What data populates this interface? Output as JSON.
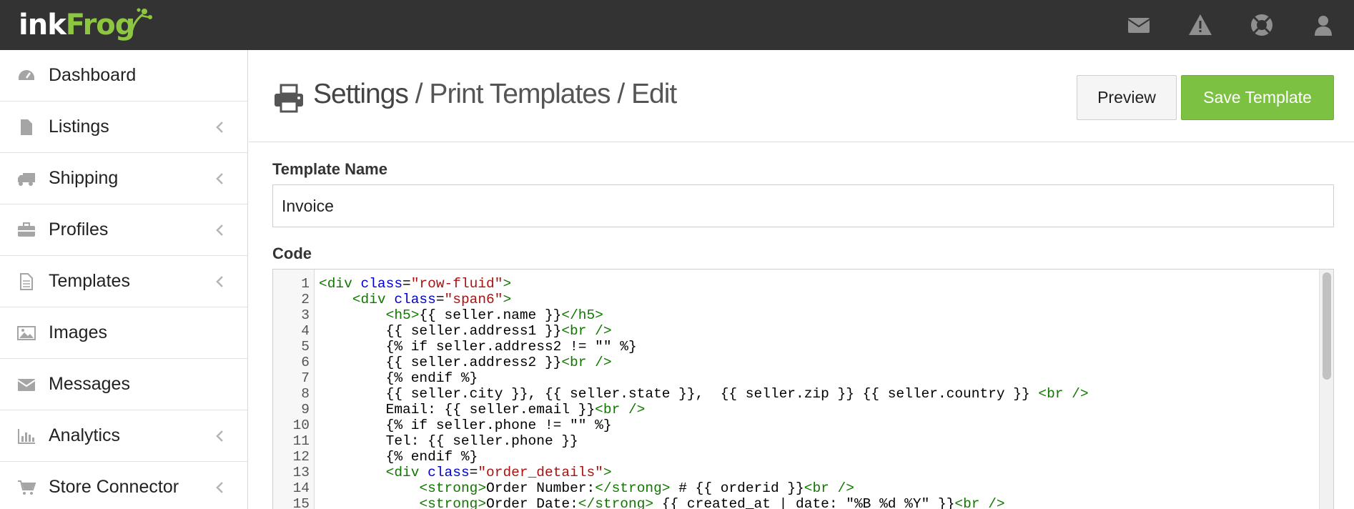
{
  "brand": {
    "ink": "ink",
    "frog": "Frog",
    "accent": "#8dc63f"
  },
  "topbar": {
    "icons": [
      "envelope-icon",
      "warning-icon",
      "lifebuoy-icon",
      "user-icon"
    ]
  },
  "sidebar": {
    "items": [
      {
        "label": "Dashboard",
        "icon": "dashboard-icon",
        "expandable": false
      },
      {
        "label": "Listings",
        "icon": "file-icon",
        "expandable": true
      },
      {
        "label": "Shipping",
        "icon": "truck-icon",
        "expandable": true
      },
      {
        "label": "Profiles",
        "icon": "briefcase-icon",
        "expandable": true
      },
      {
        "label": "Templates",
        "icon": "document-icon",
        "expandable": true
      },
      {
        "label": "Images",
        "icon": "image-icon",
        "expandable": false
      },
      {
        "label": "Messages",
        "icon": "envelope-icon",
        "expandable": false
      },
      {
        "label": "Analytics",
        "icon": "bar-chart-icon",
        "expandable": true
      },
      {
        "label": "Store Connector",
        "icon": "cart-icon",
        "expandable": true
      }
    ]
  },
  "header": {
    "title": "Settings",
    "breadcrumb": " / Print Templates / Edit",
    "preview_label": "Preview",
    "save_label": "Save Template",
    "save_color": "#7cc142"
  },
  "form": {
    "name_label": "Template Name",
    "name_value": "Invoice",
    "code_label": "Code"
  },
  "code": {
    "lines": [
      {
        "n": "1",
        "tokens": [
          [
            "tag",
            "<div "
          ],
          [
            "attr",
            "class"
          ],
          [
            "plain",
            "="
          ],
          [
            "str",
            "\"row-fluid\""
          ],
          [
            "tag",
            ">"
          ]
        ]
      },
      {
        "n": "2",
        "tokens": [
          [
            "plain",
            "    "
          ],
          [
            "tag",
            "<div "
          ],
          [
            "attr",
            "class"
          ],
          [
            "plain",
            "="
          ],
          [
            "str",
            "\"span6\""
          ],
          [
            "tag",
            ">"
          ]
        ]
      },
      {
        "n": "3",
        "tokens": [
          [
            "plain",
            "        "
          ],
          [
            "tag",
            "<h5>"
          ],
          [
            "plain",
            "{{ seller.name }}"
          ],
          [
            "tag",
            "</h5>"
          ]
        ]
      },
      {
        "n": "4",
        "tokens": [
          [
            "plain",
            "        {{ seller.address1 }}"
          ],
          [
            "tag",
            "<br />"
          ]
        ]
      },
      {
        "n": "5",
        "tokens": [
          [
            "plain",
            "        {% if seller.address2 != \"\" %}"
          ]
        ]
      },
      {
        "n": "6",
        "tokens": [
          [
            "plain",
            "        {{ seller.address2 }}"
          ],
          [
            "tag",
            "<br />"
          ]
        ]
      },
      {
        "n": "7",
        "tokens": [
          [
            "plain",
            "        {% endif %}"
          ]
        ]
      },
      {
        "n": "8",
        "tokens": [
          [
            "plain",
            "        {{ seller.city }}, {{ seller.state }},  {{ seller.zip }} {{ seller.country }} "
          ],
          [
            "tag",
            "<br />"
          ]
        ]
      },
      {
        "n": "9",
        "tokens": [
          [
            "plain",
            "        Email: {{ seller.email }}"
          ],
          [
            "tag",
            "<br />"
          ]
        ]
      },
      {
        "n": "10",
        "tokens": [
          [
            "plain",
            "        {% if seller.phone != \"\" %}"
          ]
        ]
      },
      {
        "n": "11",
        "tokens": [
          [
            "plain",
            "        Tel: {{ seller.phone }}"
          ]
        ]
      },
      {
        "n": "12",
        "tokens": [
          [
            "plain",
            "        {% endif %}"
          ]
        ]
      },
      {
        "n": "13",
        "tokens": [
          [
            "plain",
            "        "
          ],
          [
            "tag",
            "<div "
          ],
          [
            "attr",
            "class"
          ],
          [
            "plain",
            "="
          ],
          [
            "str",
            "\"order_details\""
          ],
          [
            "tag",
            ">"
          ]
        ]
      },
      {
        "n": "14",
        "tokens": [
          [
            "plain",
            "            "
          ],
          [
            "tag",
            "<strong>"
          ],
          [
            "plain",
            "Order Number:"
          ],
          [
            "tag",
            "</strong>"
          ],
          [
            "plain",
            " # {{ orderid }}"
          ],
          [
            "tag",
            "<br />"
          ]
        ]
      },
      {
        "n": "15",
        "tokens": [
          [
            "plain",
            "            "
          ],
          [
            "tag",
            "<strong>"
          ],
          [
            "plain",
            "Order Date:"
          ],
          [
            "tag",
            "</strong>"
          ],
          [
            "plain",
            " {{ created_at | date: \"%B %d %Y\" }}"
          ],
          [
            "tag",
            "<br />"
          ]
        ]
      }
    ]
  }
}
